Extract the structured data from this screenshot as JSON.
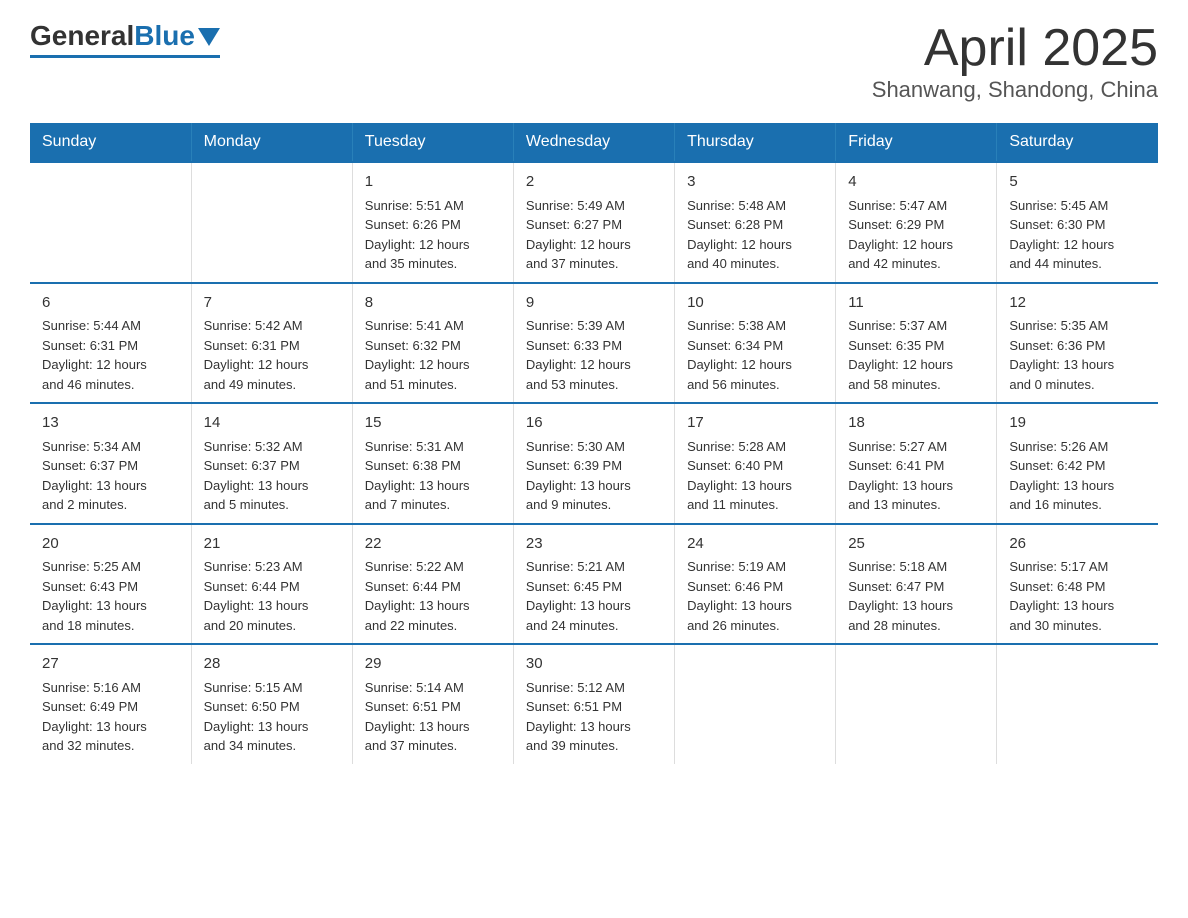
{
  "header": {
    "logo_general": "General",
    "logo_blue": "Blue",
    "title": "April 2025",
    "subtitle": "Shanwang, Shandong, China"
  },
  "calendar": {
    "days_of_week": [
      "Sunday",
      "Monday",
      "Tuesday",
      "Wednesday",
      "Thursday",
      "Friday",
      "Saturday"
    ],
    "weeks": [
      [
        {
          "day": "",
          "info": ""
        },
        {
          "day": "",
          "info": ""
        },
        {
          "day": "1",
          "info": "Sunrise: 5:51 AM\nSunset: 6:26 PM\nDaylight: 12 hours\nand 35 minutes."
        },
        {
          "day": "2",
          "info": "Sunrise: 5:49 AM\nSunset: 6:27 PM\nDaylight: 12 hours\nand 37 minutes."
        },
        {
          "day": "3",
          "info": "Sunrise: 5:48 AM\nSunset: 6:28 PM\nDaylight: 12 hours\nand 40 minutes."
        },
        {
          "day": "4",
          "info": "Sunrise: 5:47 AM\nSunset: 6:29 PM\nDaylight: 12 hours\nand 42 minutes."
        },
        {
          "day": "5",
          "info": "Sunrise: 5:45 AM\nSunset: 6:30 PM\nDaylight: 12 hours\nand 44 minutes."
        }
      ],
      [
        {
          "day": "6",
          "info": "Sunrise: 5:44 AM\nSunset: 6:31 PM\nDaylight: 12 hours\nand 46 minutes."
        },
        {
          "day": "7",
          "info": "Sunrise: 5:42 AM\nSunset: 6:31 PM\nDaylight: 12 hours\nand 49 minutes."
        },
        {
          "day": "8",
          "info": "Sunrise: 5:41 AM\nSunset: 6:32 PM\nDaylight: 12 hours\nand 51 minutes."
        },
        {
          "day": "9",
          "info": "Sunrise: 5:39 AM\nSunset: 6:33 PM\nDaylight: 12 hours\nand 53 minutes."
        },
        {
          "day": "10",
          "info": "Sunrise: 5:38 AM\nSunset: 6:34 PM\nDaylight: 12 hours\nand 56 minutes."
        },
        {
          "day": "11",
          "info": "Sunrise: 5:37 AM\nSunset: 6:35 PM\nDaylight: 12 hours\nand 58 minutes."
        },
        {
          "day": "12",
          "info": "Sunrise: 5:35 AM\nSunset: 6:36 PM\nDaylight: 13 hours\nand 0 minutes."
        }
      ],
      [
        {
          "day": "13",
          "info": "Sunrise: 5:34 AM\nSunset: 6:37 PM\nDaylight: 13 hours\nand 2 minutes."
        },
        {
          "day": "14",
          "info": "Sunrise: 5:32 AM\nSunset: 6:37 PM\nDaylight: 13 hours\nand 5 minutes."
        },
        {
          "day": "15",
          "info": "Sunrise: 5:31 AM\nSunset: 6:38 PM\nDaylight: 13 hours\nand 7 minutes."
        },
        {
          "day": "16",
          "info": "Sunrise: 5:30 AM\nSunset: 6:39 PM\nDaylight: 13 hours\nand 9 minutes."
        },
        {
          "day": "17",
          "info": "Sunrise: 5:28 AM\nSunset: 6:40 PM\nDaylight: 13 hours\nand 11 minutes."
        },
        {
          "day": "18",
          "info": "Sunrise: 5:27 AM\nSunset: 6:41 PM\nDaylight: 13 hours\nand 13 minutes."
        },
        {
          "day": "19",
          "info": "Sunrise: 5:26 AM\nSunset: 6:42 PM\nDaylight: 13 hours\nand 16 minutes."
        }
      ],
      [
        {
          "day": "20",
          "info": "Sunrise: 5:25 AM\nSunset: 6:43 PM\nDaylight: 13 hours\nand 18 minutes."
        },
        {
          "day": "21",
          "info": "Sunrise: 5:23 AM\nSunset: 6:44 PM\nDaylight: 13 hours\nand 20 minutes."
        },
        {
          "day": "22",
          "info": "Sunrise: 5:22 AM\nSunset: 6:44 PM\nDaylight: 13 hours\nand 22 minutes."
        },
        {
          "day": "23",
          "info": "Sunrise: 5:21 AM\nSunset: 6:45 PM\nDaylight: 13 hours\nand 24 minutes."
        },
        {
          "day": "24",
          "info": "Sunrise: 5:19 AM\nSunset: 6:46 PM\nDaylight: 13 hours\nand 26 minutes."
        },
        {
          "day": "25",
          "info": "Sunrise: 5:18 AM\nSunset: 6:47 PM\nDaylight: 13 hours\nand 28 minutes."
        },
        {
          "day": "26",
          "info": "Sunrise: 5:17 AM\nSunset: 6:48 PM\nDaylight: 13 hours\nand 30 minutes."
        }
      ],
      [
        {
          "day": "27",
          "info": "Sunrise: 5:16 AM\nSunset: 6:49 PM\nDaylight: 13 hours\nand 32 minutes."
        },
        {
          "day": "28",
          "info": "Sunrise: 5:15 AM\nSunset: 6:50 PM\nDaylight: 13 hours\nand 34 minutes."
        },
        {
          "day": "29",
          "info": "Sunrise: 5:14 AM\nSunset: 6:51 PM\nDaylight: 13 hours\nand 37 minutes."
        },
        {
          "day": "30",
          "info": "Sunrise: 5:12 AM\nSunset: 6:51 PM\nDaylight: 13 hours\nand 39 minutes."
        },
        {
          "day": "",
          "info": ""
        },
        {
          "day": "",
          "info": ""
        },
        {
          "day": "",
          "info": ""
        }
      ]
    ]
  }
}
